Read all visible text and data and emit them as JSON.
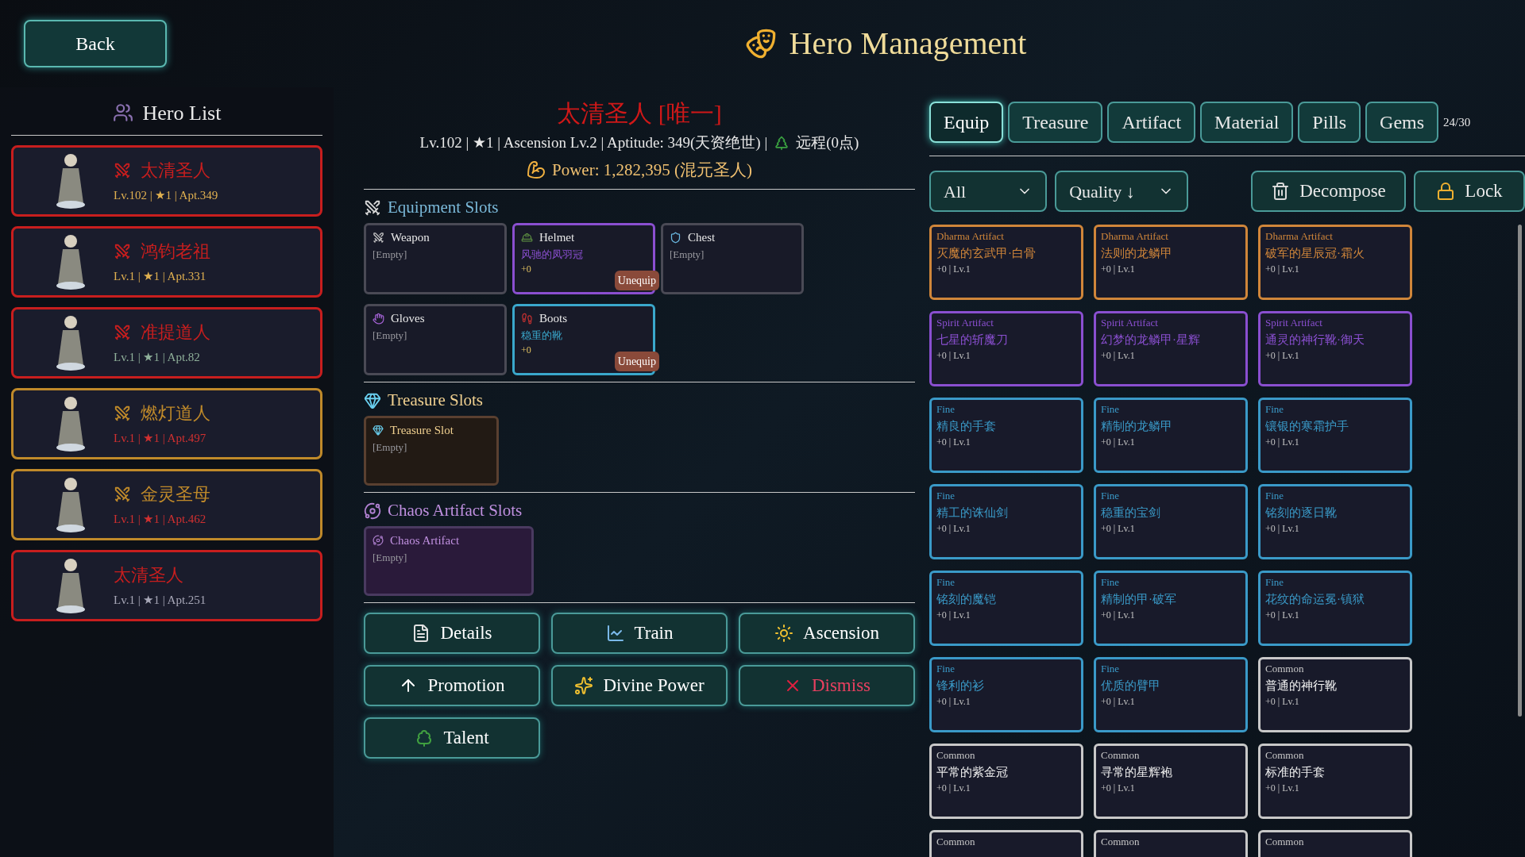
{
  "header": {
    "back": "Back",
    "title": "Hero Management"
  },
  "hero_list": {
    "title": "Hero List",
    "heroes": [
      {
        "name": "太清圣人",
        "color": "#c81e1e",
        "crossed": true,
        "stats": {
          "text": "Lv.102 | ★1 | Apt.349",
          "color": "#e0b050"
        }
      },
      {
        "name": "鸿钧老祖",
        "color": "#c81e1e",
        "crossed": true,
        "stats": {
          "text": "Lv.1 | ★1 | Apt.331",
          "color": "#e0b050"
        }
      },
      {
        "name": "准提道人",
        "color": "#c81e1e",
        "crossed": true,
        "stats": {
          "text": "Lv.1 | ★1 | Apt.82",
          "color": "#8fb09a"
        }
      },
      {
        "name": "燃灯道人",
        "color": "#c08a2a",
        "crossed": true,
        "stats": {
          "text": "Lv.1 | ★1 | Apt.497",
          "color": "#d03030"
        }
      },
      {
        "name": "金灵圣母",
        "color": "#c08a2a",
        "crossed": true,
        "stats": {
          "text": "Lv.1 | ★1 | Apt.462",
          "color": "#d03030"
        }
      },
      {
        "name": "太清圣人",
        "color": "#c81e1e",
        "crossed": false,
        "stats": {
          "text": "Lv.1 | ★1 | Apt.251",
          "color": "#a8a8b8"
        }
      }
    ]
  },
  "hero": {
    "name": "太清圣人 [唯一]",
    "stats": "Lv.102 | ★1 | Ascension Lv.2 | Aptitude: 349(天资绝世) |",
    "range": "远程(0点)",
    "power": "Power: 1,282,395 (混元圣人)"
  },
  "equipment": {
    "title": "Equipment Slots",
    "slots": [
      {
        "kind": "weapon",
        "label": "Weapon",
        "empty": "[Empty]",
        "color": "#4a4a55"
      },
      {
        "kind": "helmet",
        "label": "Helmet",
        "item": "风驰的凤羽冠",
        "plus": "+0",
        "action": "Unequip",
        "color": "#8a4fd0"
      },
      {
        "kind": "chest",
        "label": "Chest",
        "empty": "[Empty]",
        "color": "#4a4a55"
      },
      {
        "kind": "gloves",
        "label": "Gloves",
        "empty": "[Empty]",
        "color": "#4a4a55"
      },
      {
        "kind": "boots",
        "label": "Boots",
        "item": "稳重的靴",
        "plus": "+0",
        "action": "Unequip",
        "color": "#3aa8cc"
      }
    ]
  },
  "treasure": {
    "title": "Treasure Slots",
    "slots": [
      {
        "label": "Treasure Slot",
        "empty": "[Empty]"
      }
    ]
  },
  "chaos": {
    "title": "Chaos Artifact Slots",
    "slots": [
      {
        "label": "Chaos Artifact",
        "empty": "[Empty]"
      }
    ]
  },
  "actions": [
    {
      "label": "Details",
      "kind": "normal"
    },
    {
      "label": "Train",
      "kind": "normal"
    },
    {
      "label": "Ascension",
      "kind": "normal"
    },
    {
      "label": "Promotion",
      "kind": "normal"
    },
    {
      "label": "Divine Power",
      "kind": "normal"
    },
    {
      "label": "Dismiss",
      "kind": "danger"
    },
    {
      "label": "Talent",
      "kind": "normal"
    }
  ],
  "inventory": {
    "tabs": [
      {
        "label": "Equip",
        "selected": true
      },
      {
        "label": "Treasure",
        "selected": false
      },
      {
        "label": "Artifact",
        "selected": false
      },
      {
        "label": "Material",
        "selected": false
      },
      {
        "label": "Pills",
        "selected": false
      },
      {
        "label": "Gems",
        "selected": false
      }
    ],
    "count": "24/30",
    "filter": "All",
    "sort": "Quality ↓",
    "decompose": "Decompose",
    "lock": "Lock",
    "items": [
      {
        "grade": "Dharma Artifact",
        "color": "#d0863a",
        "name": "灭魔的玄武甲·白骨",
        "stats": "+0 | Lv.1"
      },
      {
        "grade": "Dharma Artifact",
        "color": "#d0863a",
        "name": "法则的龙鳞甲",
        "stats": "+0 | Lv.1"
      },
      {
        "grade": "Dharma Artifact",
        "color": "#d0863a",
        "name": "破军的星辰冠·霜火",
        "stats": "+0 | Lv.1"
      },
      {
        "grade": "Spirit Artifact",
        "color": "#8a4fd0",
        "name": "七星的斩魔刀",
        "stats": "+0 | Lv.1"
      },
      {
        "grade": "Spirit Artifact",
        "color": "#8a4fd0",
        "name": "幻梦的龙鳞甲·星辉",
        "stats": "+0 | Lv.1"
      },
      {
        "grade": "Spirit Artifact",
        "color": "#8a4fd0",
        "name": "通灵的神行靴·御天",
        "stats": "+0 | Lv.1"
      },
      {
        "grade": "Fine",
        "color": "#3a9ac8",
        "name": "精良的手套",
        "stats": "+0 | Lv.1"
      },
      {
        "grade": "Fine",
        "color": "#3a9ac8",
        "name": "精制的龙鳞甲",
        "stats": "+0 | Lv.1"
      },
      {
        "grade": "Fine",
        "color": "#3a9ac8",
        "name": "镶银的寒霜护手",
        "stats": "+0 | Lv.1"
      },
      {
        "grade": "Fine",
        "color": "#3a9ac8",
        "name": "精工的诛仙剑",
        "stats": "+0 | Lv.1"
      },
      {
        "grade": "Fine",
        "color": "#3a9ac8",
        "name": "稳重的宝剑",
        "stats": "+0 | Lv.1"
      },
      {
        "grade": "Fine",
        "color": "#3a9ac8",
        "name": "铭刻的逐日靴",
        "stats": "+0 | Lv.1"
      },
      {
        "grade": "Fine",
        "color": "#3a9ac8",
        "name": "铭刻的魔铠",
        "stats": "+0 | Lv.1"
      },
      {
        "grade": "Fine",
        "color": "#3a9ac8",
        "name": "精制的甲·破军",
        "stats": "+0 | Lv.1"
      },
      {
        "grade": "Fine",
        "color": "#3a9ac8",
        "name": "花纹的命运冕·镇狱",
        "stats": "+0 | Lv.1"
      },
      {
        "grade": "Fine",
        "color": "#3a9ac8",
        "name": "锋利的衫",
        "stats": "+0 | Lv.1"
      },
      {
        "grade": "Fine",
        "color": "#3a9ac8",
        "name": "优质的臂甲",
        "stats": "+0 | Lv.1"
      },
      {
        "grade": "Common",
        "color": "#c8c8c8",
        "name": "普通的神行靴",
        "stats": "+0 | Lv.1"
      },
      {
        "grade": "Common",
        "color": "#c8c8c8",
        "name": "平常的紫金冠",
        "stats": "+0 | Lv.1"
      },
      {
        "grade": "Common",
        "color": "#c8c8c8",
        "name": "寻常的星辉袍",
        "stats": "+0 | Lv.1"
      },
      {
        "grade": "Common",
        "color": "#c8c8c8",
        "name": "标准的手套",
        "stats": "+0 | Lv.1"
      },
      {
        "grade": "Common",
        "color": "#c8c8c8"
      },
      {
        "grade": "Common",
        "color": "#c8c8c8"
      },
      {
        "grade": "Common",
        "color": "#c8c8c8"
      }
    ]
  }
}
